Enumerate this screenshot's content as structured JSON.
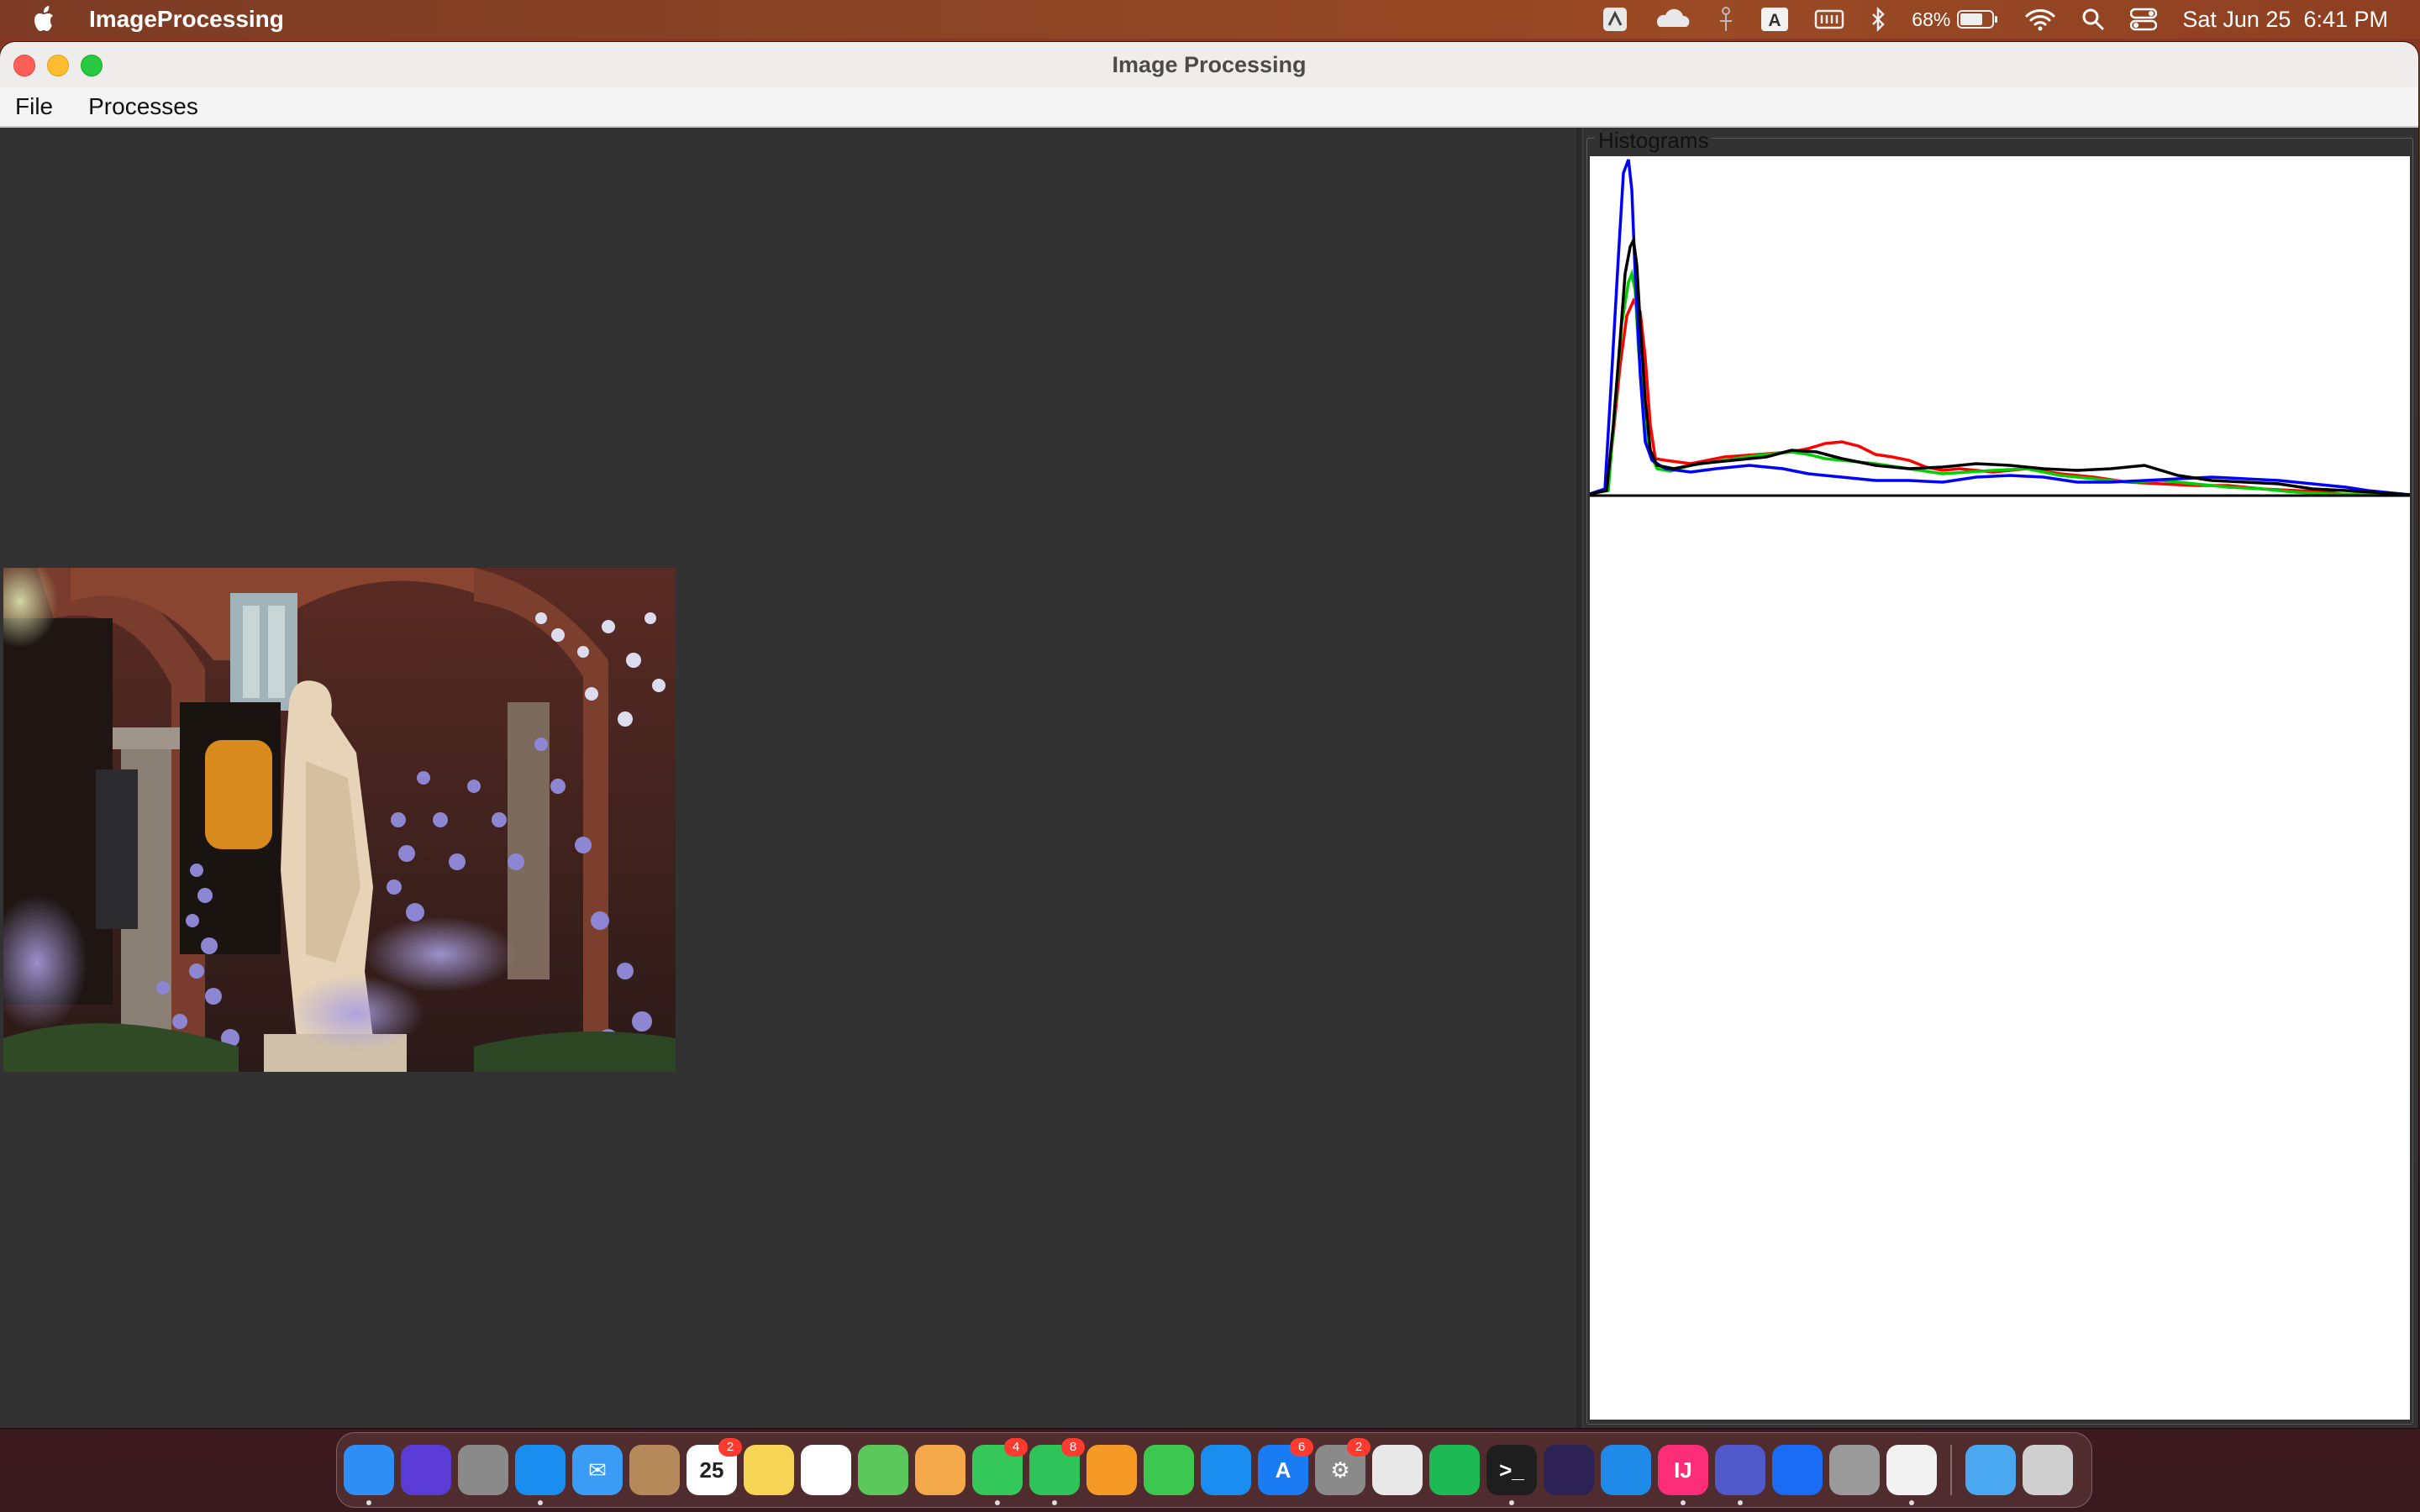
{
  "menubar": {
    "app_name": "ImageProcessing",
    "battery": "68%",
    "clock": "Sat Jun 25  6:41 PM",
    "status_icons": [
      "adobe-icon",
      "cloud-icon",
      "accessibility-icon",
      "input-source-icon",
      "memory-icon",
      "bluetooth-icon",
      "battery-icon",
      "wifi-icon",
      "spotlight-icon",
      "control-center-icon"
    ]
  },
  "window": {
    "title": "Image Processing",
    "menus": [
      "File",
      "Processes"
    ]
  },
  "histograms": {
    "title": "Histograms",
    "colors": {
      "red": "#ff0000",
      "green": "#00d000",
      "blue": "#0000ff",
      "black": "#000000"
    }
  },
  "dock": {
    "items": [
      {
        "name": "finder",
        "color": "#2e8ef5",
        "badge": "",
        "glyph": ""
      },
      {
        "name": "siri",
        "color": "#5b3bd6",
        "badge": "",
        "glyph": ""
      },
      {
        "name": "launchpad",
        "color": "#8a8a8a",
        "badge": "",
        "glyph": ""
      },
      {
        "name": "safari",
        "color": "#1a8ef0",
        "badge": "",
        "glyph": ""
      },
      {
        "name": "mail",
        "color": "#3a9cf5",
        "badge": "",
        "glyph": "✉"
      },
      {
        "name": "contacts",
        "color": "#b58a5a",
        "badge": "",
        "glyph": ""
      },
      {
        "name": "calendar",
        "color": "#ffffff",
        "badge": "2",
        "glyph": "25"
      },
      {
        "name": "notes",
        "color": "#f6d454",
        "badge": "",
        "glyph": ""
      },
      {
        "name": "reminders",
        "color": "#ffffff",
        "badge": "",
        "glyph": ""
      },
      {
        "name": "maps",
        "color": "#5ac85a",
        "badge": "",
        "glyph": ""
      },
      {
        "name": "photos",
        "color": "#f3a94a",
        "badge": "",
        "glyph": ""
      },
      {
        "name": "messages",
        "color": "#34c759",
        "badge": "4",
        "glyph": ""
      },
      {
        "name": "facetime",
        "color": "#2fc45a",
        "badge": "8",
        "glyph": ""
      },
      {
        "name": "pages",
        "color": "#f59a25",
        "badge": "",
        "glyph": ""
      },
      {
        "name": "numbers",
        "color": "#3cc850",
        "badge": "",
        "glyph": ""
      },
      {
        "name": "keynote",
        "color": "#1a8ef0",
        "badge": "",
        "glyph": ""
      },
      {
        "name": "app-store",
        "color": "#1a7cf5",
        "badge": "6",
        "glyph": "A"
      },
      {
        "name": "system-preferences",
        "color": "#8a8a8a",
        "badge": "2",
        "glyph": "⚙"
      },
      {
        "name": "chrome",
        "color": "#e8e8e8",
        "badge": "",
        "glyph": ""
      },
      {
        "name": "spotify",
        "color": "#1db954",
        "badge": "",
        "glyph": ""
      },
      {
        "name": "terminal",
        "color": "#1e1e1e",
        "badge": "",
        "glyph": ">_"
      },
      {
        "name": "eclipse",
        "color": "#2c2255",
        "badge": "",
        "glyph": ""
      },
      {
        "name": "vscode",
        "color": "#1f8ae8",
        "badge": "",
        "glyph": ""
      },
      {
        "name": "intellij",
        "color": "#fe2d78",
        "badge": "",
        "glyph": "IJ"
      },
      {
        "name": "teams",
        "color": "#5059c9",
        "badge": "",
        "glyph": ""
      },
      {
        "name": "pencil-app",
        "color": "#1a6cf5",
        "badge": "",
        "glyph": ""
      },
      {
        "name": "disk-utility",
        "color": "#9a9a9a",
        "badge": "",
        "glyph": ""
      },
      {
        "name": "java-app",
        "color": "#f2f2f2",
        "badge": "",
        "glyph": ""
      }
    ],
    "stack_items": [
      {
        "name": "downloads-folder",
        "color": "#4aa8f0",
        "badge": "",
        "glyph": ""
      },
      {
        "name": "trash",
        "color": "#cfcfcf",
        "badge": "",
        "glyph": ""
      }
    ]
  }
}
